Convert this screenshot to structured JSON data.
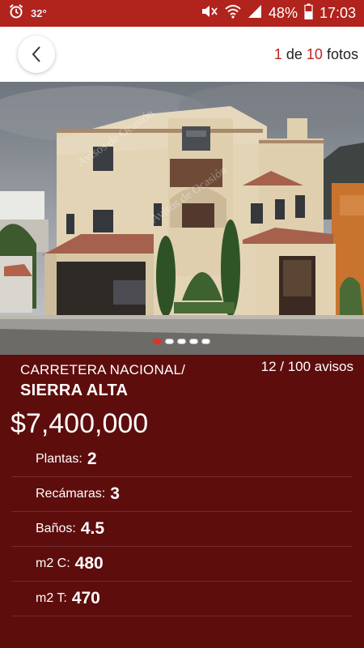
{
  "status_bar": {
    "temperature": "32°",
    "battery": "48%",
    "time": "17:03"
  },
  "header": {
    "current_photo": "1",
    "photos_sep": "de",
    "total_photos": "10",
    "photos_label": "fotos"
  },
  "gallery": {
    "dot_count": 5,
    "active_dot": 0,
    "watermark": "Avisos de Ocasión"
  },
  "listing": {
    "location_line1": "CARRETERA NACIONAL/",
    "location_line2": "SIERRA ALTA",
    "avisos_counter": "12 / 100 avisos",
    "price": "$7,400,000",
    "specs": [
      {
        "label": "Plantas:",
        "value": "2"
      },
      {
        "label": "Recámaras:",
        "value": "3"
      },
      {
        "label": "Baños:",
        "value": "4.5"
      },
      {
        "label": "m2 C:",
        "value": "480"
      },
      {
        "label": "m2 T:",
        "value": "470"
      }
    ]
  },
  "colors": {
    "status_bar": "#b1231d",
    "accent": "#c0251e",
    "detail_background": "#5e0d0d"
  }
}
